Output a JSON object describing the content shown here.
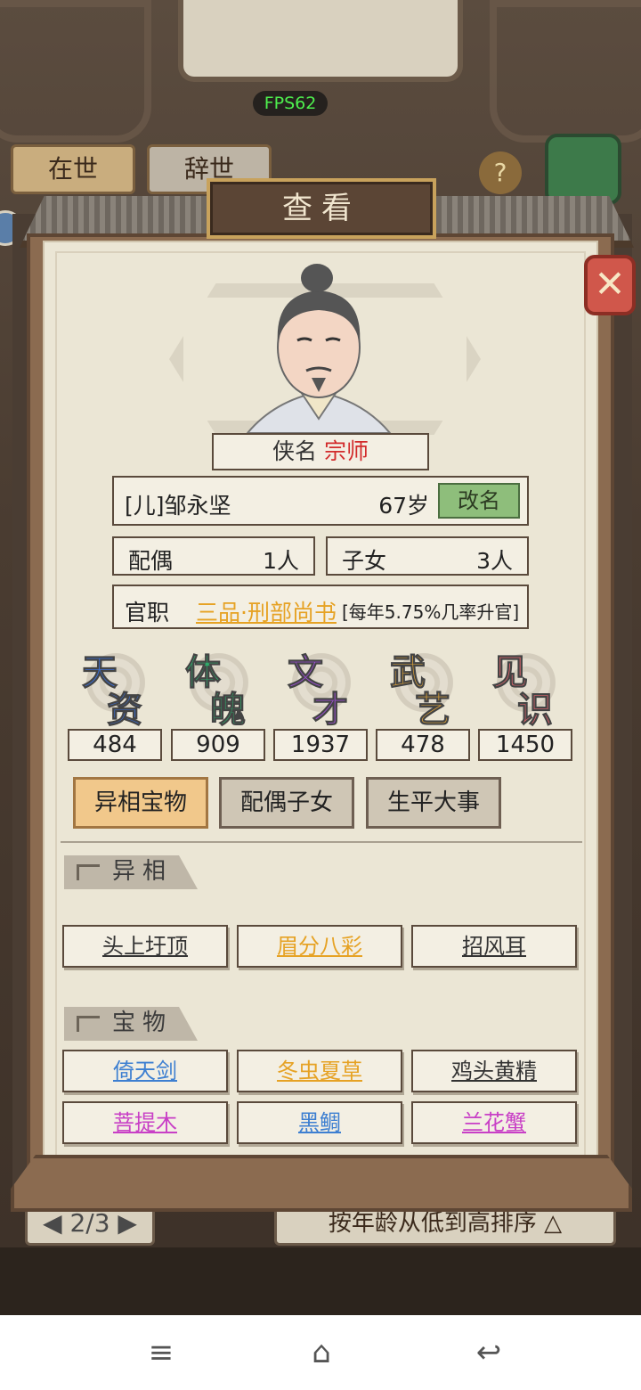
{
  "hud": {
    "fps": "FPS62"
  },
  "background": {
    "tab_alive": "在世",
    "tab_deceased": "辞世",
    "help": "?",
    "pager": "2/3",
    "sort_label": "按年龄从低到高排序"
  },
  "dialog": {
    "title": "查看",
    "close": "✕",
    "hero_name_label": "侠名",
    "hero_title": "宗师",
    "person_name": "[儿]邹永坚",
    "age": "67岁",
    "rename_button": "改名",
    "spouse_label": "配偶",
    "spouse_count": "1人",
    "children_label": "子女",
    "children_count": "3人",
    "office_label": "官职",
    "office_value": "三品·刑部尚书",
    "promotion_rate": "[每年5.75%几率升官]",
    "attributes": [
      {
        "name_a": "天",
        "name_b": "资",
        "value": "484",
        "color": "#3b6fd6"
      },
      {
        "name_a": "体",
        "name_b": "魄",
        "value": "909",
        "color": "#2faa6a"
      },
      {
        "name_a": "文",
        "name_b": "才",
        "value": "1937",
        "color": "#9b4fd0"
      },
      {
        "name_a": "武",
        "name_b": "艺",
        "value": "478",
        "color": "#e2a63a"
      },
      {
        "name_a": "见",
        "name_b": "识",
        "value": "1450",
        "color": "#e3676f"
      }
    ],
    "tabs": [
      "异相宝物",
      "配偶子女",
      "生平大事"
    ],
    "active_tab": "异相宝物",
    "section_traits": "异相",
    "traits": [
      {
        "label": "头上圩顶",
        "color": "#333333"
      },
      {
        "label": "眉分八彩",
        "color": "#e6a224"
      },
      {
        "label": "招风耳",
        "color": "#333333"
      }
    ],
    "section_treasures": "宝物",
    "treasures": [
      {
        "label": "倚天剑",
        "color": "#3d7fd1"
      },
      {
        "label": "冬虫夏草",
        "color": "#e6a224"
      },
      {
        "label": "鸡头黄精",
        "color": "#333333"
      },
      {
        "label": "菩提木",
        "color": "#c83fc6"
      },
      {
        "label": "黑鲷",
        "color": "#3d7fd1"
      },
      {
        "label": "兰花蟹",
        "color": "#c83fc6"
      }
    ]
  },
  "navbar": {
    "menu": "≡",
    "home": "⌂",
    "back": "↩"
  }
}
